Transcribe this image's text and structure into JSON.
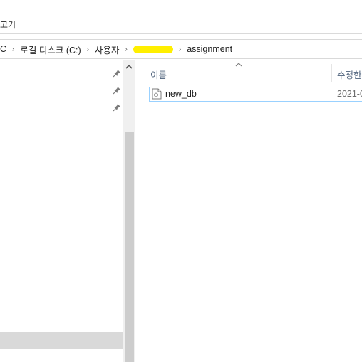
{
  "ribbon": {
    "tab_fragment": "고기"
  },
  "address_bar": {
    "crumbs": [
      {
        "label": "C"
      },
      {
        "label": "로컬 디스크 (C:)"
      },
      {
        "label": "사용자"
      },
      {
        "label": ""
      },
      {
        "label": "assignment"
      }
    ],
    "separator": "›"
  },
  "nav_pane": {
    "pinned_icons": [
      "pin-icon",
      "pin-icon",
      "pin-icon"
    ],
    "scroll_up_glyph": "^"
  },
  "file_list": {
    "columns": [
      {
        "label": "이름"
      },
      {
        "label": "수정한"
      }
    ],
    "sort_glyph": "^",
    "rows": [
      {
        "name": "new_db",
        "modified": "2021-0",
        "icon": "text-file-icon"
      }
    ]
  },
  "colors": {
    "selection_border": "#99d1ff",
    "redaction": "#ffef00",
    "header_text": "#4c607a"
  }
}
